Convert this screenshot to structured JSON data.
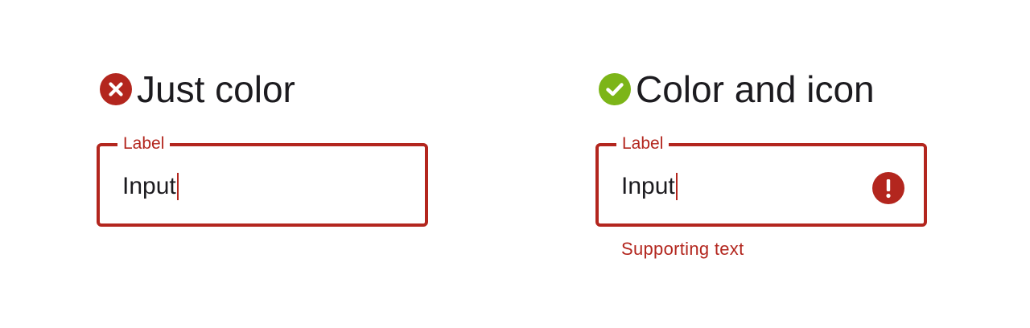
{
  "colors": {
    "error": "#b3261e",
    "success": "#7cb518",
    "text": "#1c1b1f"
  },
  "examples": [
    {
      "title": "Just color",
      "status_icon": "close-circle-icon",
      "field": {
        "label": "Label",
        "value": "Input"
      }
    },
    {
      "title": "Color and icon",
      "status_icon": "check-circle-icon",
      "field": {
        "label": "Label",
        "value": "Input",
        "trailing_icon": "error-exclamation-icon"
      },
      "supporting_text": "Supporting text"
    }
  ]
}
